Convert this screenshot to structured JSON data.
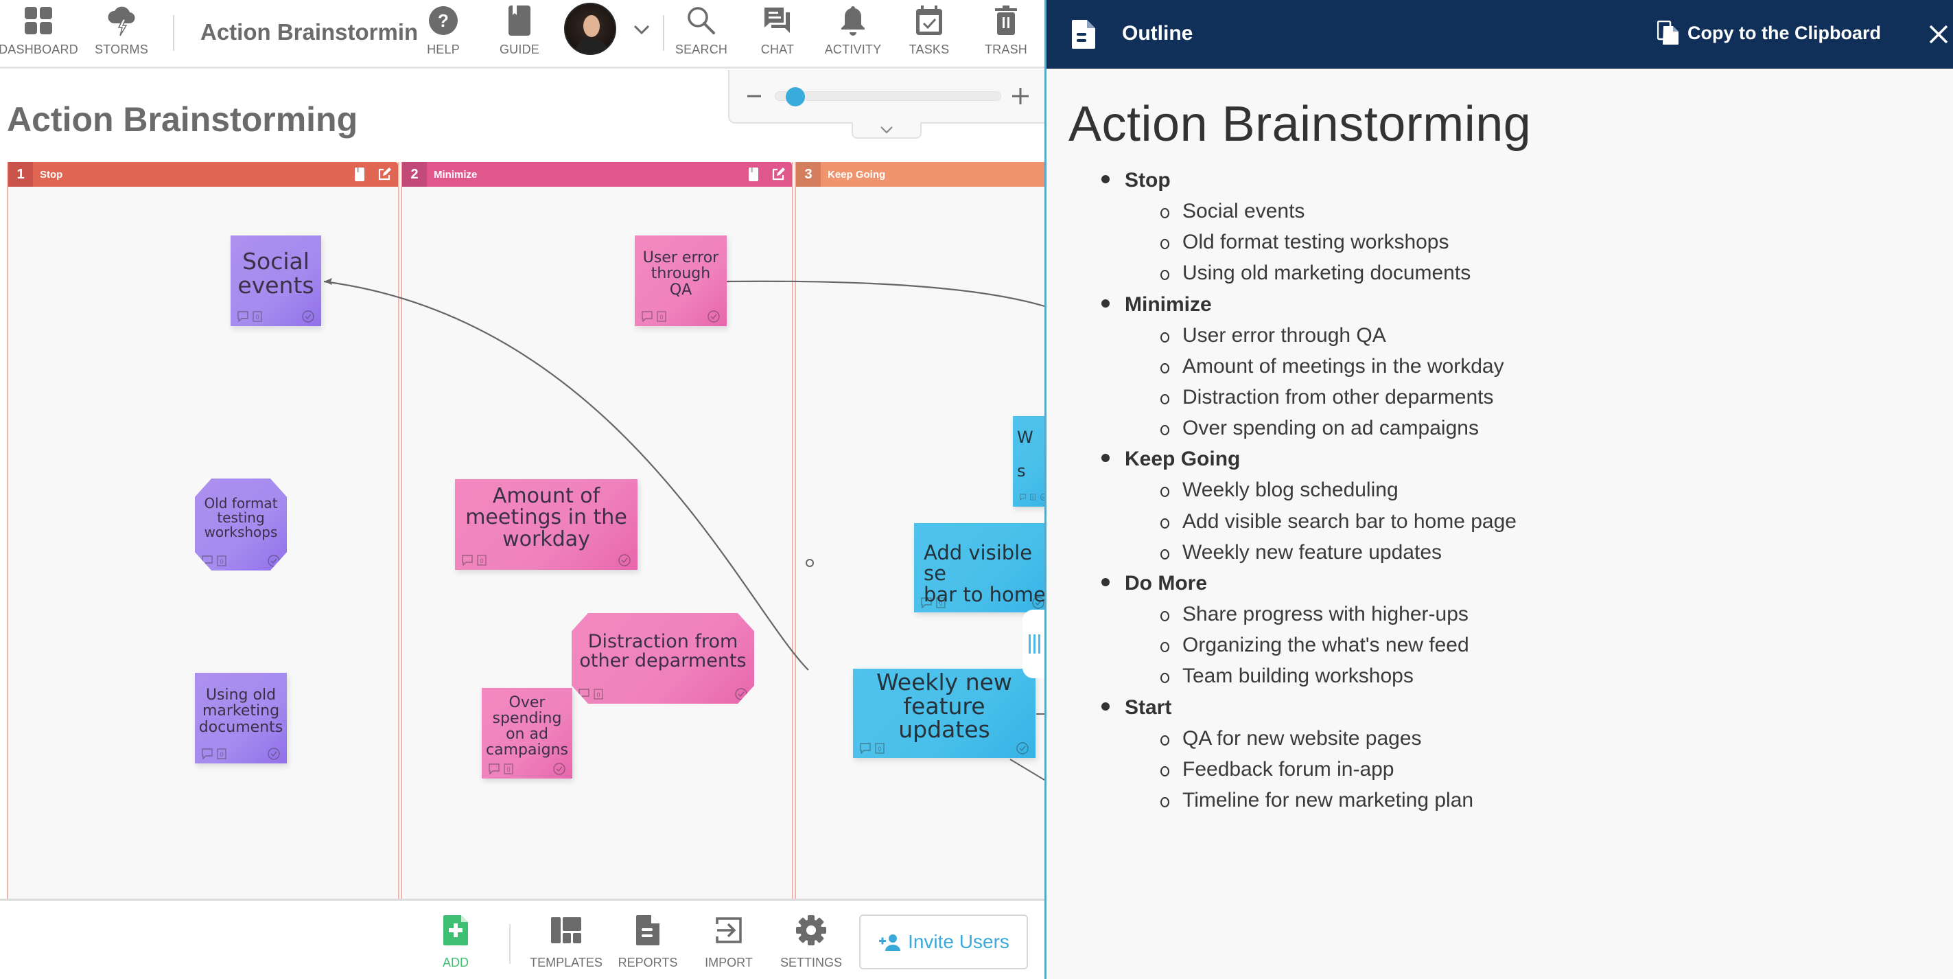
{
  "topbar": {
    "dashboard": "DASHBOARD",
    "storms": "STORMS",
    "board_name": "Action Brainstormin",
    "help": "HELP",
    "guide": "GUIDE",
    "search": "SEARCH",
    "chat": "CHAT",
    "activity": "ACTIVITY",
    "tasks": "TASKS",
    "trash": "TRASH"
  },
  "zoom": {
    "level_fraction": 0.05
  },
  "board": {
    "title": "Action Brainstorming",
    "columns": [
      {
        "number": "1",
        "title": "Stop",
        "color": "#e06552",
        "num_color": "#c9544a"
      },
      {
        "number": "2",
        "title": "Minimize",
        "color": "#df578b",
        "num_color": "#c24a79"
      },
      {
        "number": "3",
        "title": "Keep Going",
        "color": "#f0946e",
        "num_color": "#d47e5e"
      }
    ],
    "notes": [
      {
        "text": "Social events",
        "color": "purple",
        "shape": "rect"
      },
      {
        "text": "Old format testing workshops",
        "color": "purple",
        "shape": "octagon"
      },
      {
        "text": "Using old marketing documents",
        "color": "purple",
        "shape": "rect"
      },
      {
        "text": "User error through QA",
        "color": "pink",
        "shape": "rect"
      },
      {
        "text": "Amount of meetings in the workday",
        "color": "pink",
        "shape": "rect"
      },
      {
        "text": "Distraction from other deparments",
        "color": "pink",
        "shape": "octagon"
      },
      {
        "text": "Over spending on ad campaigns",
        "color": "pink",
        "shape": "rect"
      },
      {
        "text": "W",
        "text2": "s",
        "color": "blue",
        "shape": "rect"
      },
      {
        "text": "Add visible se\nbar to home",
        "color": "blue",
        "shape": "rect"
      },
      {
        "text": "Weekly new feature updates",
        "color": "blue",
        "shape": "rect"
      }
    ],
    "note_badge_count": "0"
  },
  "bottombar": {
    "add": "ADD",
    "templates": "TEMPLATES",
    "reports": "REPORTS",
    "import": "IMPORT",
    "settings": "SETTINGS",
    "invite": "Invite Users"
  },
  "outline_panel": {
    "header_title": "Outline",
    "copy_label": "Copy to the Clipboard",
    "doc_title": "Action Brainstorming",
    "sections": [
      {
        "title": "Stop",
        "items": [
          "Social events",
          "Old format testing workshops",
          "Using old marketing documents"
        ]
      },
      {
        "title": "Minimize",
        "items": [
          "User error through QA",
          "Amount of meetings in the workday",
          "Distraction from other deparments",
          "Over spending on ad campaigns"
        ]
      },
      {
        "title": "Keep Going",
        "items": [
          "Weekly blog scheduling",
          "Add visible search bar to home page",
          "Weekly new feature updates"
        ]
      },
      {
        "title": "Do More",
        "items": [
          "Share progress with higher-ups",
          "Organizing the what's new feed",
          "Team building workshops"
        ]
      },
      {
        "title": "Start",
        "items": [
          "QA for new website pages",
          "Feedback forum in-app",
          "Timeline for new marketing plan"
        ]
      }
    ]
  },
  "colors": {
    "accent_blue": "#3aacdc",
    "add_green": "#3fbf74",
    "panel_header": "#10305a"
  }
}
